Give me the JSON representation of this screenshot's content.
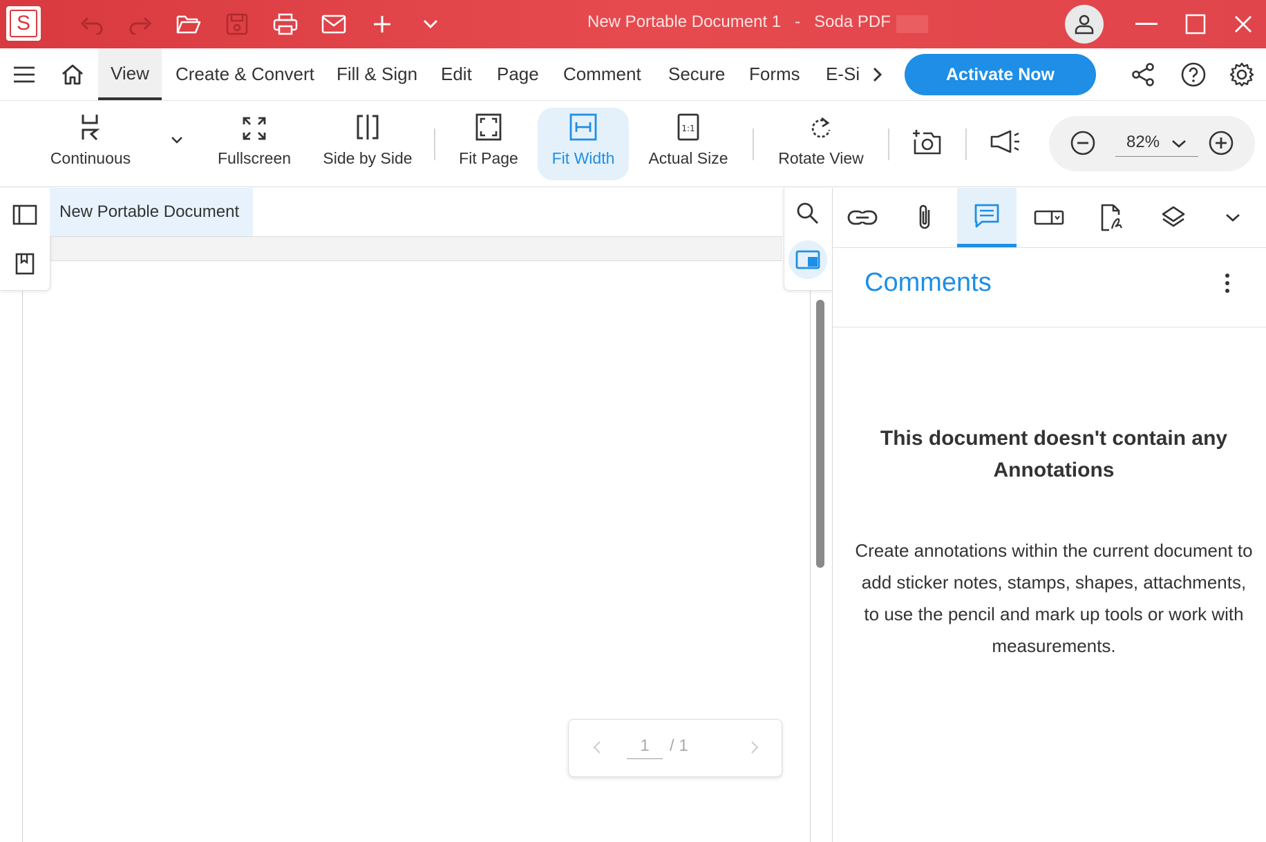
{
  "window": {
    "title": "New Portable Document 1   -   Soda PDF",
    "logo_letter": "S"
  },
  "menu": {
    "items": [
      "View",
      "Create & Convert",
      "Fill & Sign",
      "Edit",
      "Page",
      "Comment",
      "Secure",
      "Forms",
      "E-Si"
    ],
    "active": "View",
    "activate_label": "Activate Now"
  },
  "ribbon": {
    "tools": {
      "continuous": "Continuous",
      "fullscreen": "Fullscreen",
      "side_by_side": "Side by Side",
      "fit_page": "Fit Page",
      "fit_width": "Fit Width",
      "actual_size": "Actual Size",
      "rotate_view": "Rotate View"
    },
    "active_tool": "Fit Width",
    "zoom": "82%"
  },
  "document": {
    "tab_title": "New Portable Document",
    "page_current": "1",
    "page_total": "/ 1"
  },
  "panel": {
    "title": "Comments",
    "empty_heading": "This document doesn't contain any Annotations",
    "empty_body": "Create annotations within the current document to add sticker notes, stamps, shapes, attachments, to use the pencil and mark up tools or work with measurements."
  },
  "colors": {
    "brand_red": "#d83a3f",
    "accent_blue": "#1e8ee6"
  }
}
